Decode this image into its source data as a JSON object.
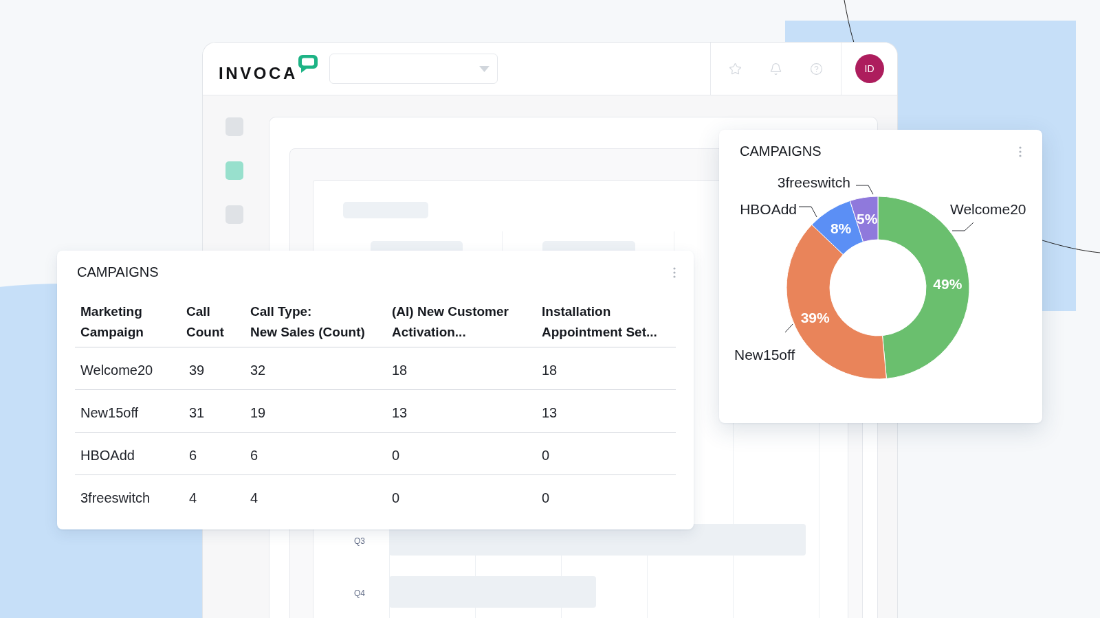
{
  "header": {
    "logo": "INVOCA",
    "avatar": "ID"
  },
  "sidebar": {
    "items": [
      {
        "selected": false
      },
      {
        "selected": true
      },
      {
        "selected": false
      }
    ]
  },
  "background_chart": {
    "row_labels": [
      "Q3",
      "Q4"
    ]
  },
  "campaign_table": {
    "title": "CAMPAIGNS",
    "columns": [
      "Marketing\nCampaign",
      "Call\nCount",
      "Call Type:\nNew Sales (Count)",
      "(AI) New Customer\nActivation...",
      "Installation\nAppointment Set..."
    ],
    "rows": [
      [
        "Welcome20",
        "39",
        "32",
        "18",
        "18"
      ],
      [
        "New15off",
        "31",
        "19",
        "13",
        "13"
      ],
      [
        "HBOAdd",
        "6",
        "6",
        "0",
        "0"
      ],
      [
        "3freeswitch",
        "4",
        "4",
        "0",
        "0"
      ]
    ]
  },
  "campaign_chart": {
    "title": "CAMPAIGNS",
    "chart_data": {
      "type": "donut",
      "categories": [
        "Welcome20",
        "New15off",
        "HBOAdd",
        "3freeswitch"
      ],
      "values": [
        49,
        39,
        8,
        5
      ],
      "colors": [
        "#6abf6e",
        "#e9845a",
        "#5b8ff5",
        "#8f79dc"
      ],
      "value_labels": [
        "49%",
        "39%",
        "8%",
        "5%"
      ]
    }
  }
}
